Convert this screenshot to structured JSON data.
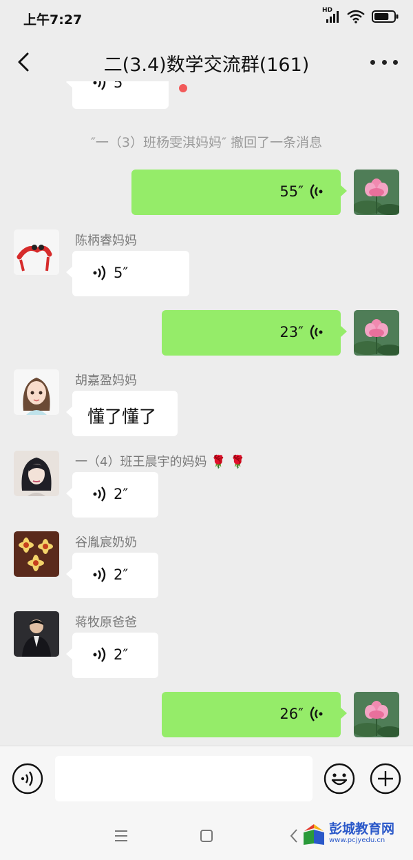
{
  "status_bar": {
    "time": "上午7:27",
    "network": "HD",
    "battery_level": 0.75
  },
  "header": {
    "title": "二(3.4)数学交流群(161)"
  },
  "messages": [
    {
      "type": "voice",
      "side": "in",
      "duration": "5″",
      "unread": true
    },
    {
      "type": "system",
      "text": "″一（3）班杨雯淇妈妈″ 撤回了一条消息"
    },
    {
      "type": "voice",
      "side": "out",
      "duration": "55″"
    },
    {
      "type": "voice",
      "side": "in",
      "sender": "陈柄睿妈妈",
      "duration": "5″"
    },
    {
      "type": "voice",
      "side": "out",
      "duration": "23″"
    },
    {
      "type": "text",
      "side": "in",
      "sender": "胡嘉盈妈妈",
      "text": "懂了懂了"
    },
    {
      "type": "voice",
      "side": "in",
      "sender": "一（4）班王晨宇的妈妈",
      "duration": "2″",
      "emoji": "🌹 🌹"
    },
    {
      "type": "voice",
      "side": "in",
      "sender": "谷胤宸奶奶",
      "duration": "2″"
    },
    {
      "type": "voice",
      "side": "in",
      "sender": "蒋牧原爸爸",
      "duration": "2″"
    },
    {
      "type": "voice",
      "side": "out",
      "duration": "26″"
    }
  ],
  "watermark": {
    "title": "彭城教育网",
    "url": "www.pcjyedu.cn"
  },
  "icons": {
    "back": "back-chevron-icon",
    "more": "more-dots-icon",
    "voice_input": "voice-input-icon",
    "emoji": "emoji-icon",
    "add": "add-icon",
    "menu": "menu-icon",
    "home": "home-icon",
    "nav_back": "back-triangle-icon"
  },
  "colors": {
    "outgoing_bubble": "#95ec69",
    "incoming_bubble": "#ffffff",
    "background": "#ededed",
    "watermark": "#2a58c9"
  }
}
